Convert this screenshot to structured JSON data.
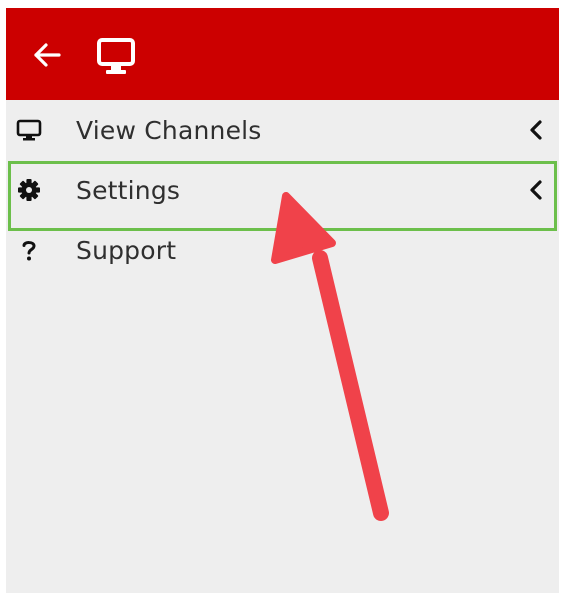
{
  "header": {
    "back_icon": "arrow-left-icon",
    "app_icon": "monitor-icon",
    "background_color": "#cc0000"
  },
  "menu": {
    "items": [
      {
        "label": "View Channels",
        "icon": "monitor-icon",
        "has_chevron": true
      },
      {
        "label": "Settings",
        "icon": "gear-icon",
        "has_chevron": true,
        "highlighted": true
      },
      {
        "label": "Support",
        "icon": "question-icon",
        "has_chevron": false
      }
    ]
  },
  "annotation": {
    "highlight_color": "#6cbf4b",
    "arrow_color": "#f0424a"
  }
}
